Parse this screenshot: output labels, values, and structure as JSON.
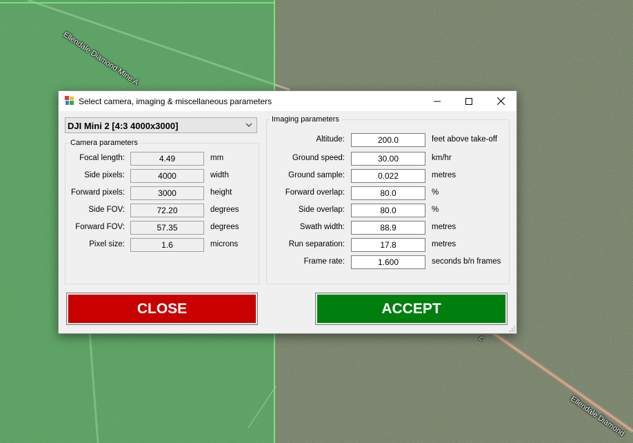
{
  "map": {
    "road_label_top": "Ellendale Diamond Mine A",
    "road_label_bottom": "Ellendale Diamond",
    "road_label_small": "c"
  },
  "dialog": {
    "title": "Select camera, imaging & miscellaneous parameters",
    "camera_select": {
      "value": "DJI Mini 2 [4:3 4000x3000]"
    },
    "camera_parameters": {
      "title": "Camera parameters",
      "rows": [
        {
          "label": "Focal length:",
          "value": "4.49",
          "unit": "mm"
        },
        {
          "label": "Side pixels:",
          "value": "4000",
          "unit": "width"
        },
        {
          "label": "Forward pixels:",
          "value": "3000",
          "unit": "height"
        },
        {
          "label": "Side FOV:",
          "value": "72.20",
          "unit": "degrees"
        },
        {
          "label": "Forward FOV:",
          "value": "57.35",
          "unit": "degrees"
        },
        {
          "label": "Pixel size:",
          "value": "1.6",
          "unit": "microns"
        }
      ]
    },
    "imaging_parameters": {
      "title": "Imaging parameters",
      "rows": [
        {
          "label": "Altitude:",
          "value": "200.0",
          "unit": "feet above take-off"
        },
        {
          "label": "Ground speed:",
          "value": "30.00",
          "unit": "km/hr"
        },
        {
          "label": "Ground sample:",
          "value": "0.022",
          "unit": "metres"
        },
        {
          "label": "Forward overlap:",
          "value": "80.0",
          "unit": "%"
        },
        {
          "label": "Side overlap:",
          "value": "80.0",
          "unit": "%"
        },
        {
          "label": "Swath width:",
          "value": "88.9",
          "unit": "metres"
        },
        {
          "label": "Run separation:",
          "value": "17.8",
          "unit": "metres"
        },
        {
          "label": "Frame rate:",
          "value": "1.600",
          "unit": "seconds b/n frames"
        }
      ]
    },
    "buttons": {
      "close": "CLOSE",
      "accept": "ACCEPT"
    }
  },
  "colors": {
    "close_button": "#c80000",
    "accept_button": "#007f0e",
    "map_overlay": "#3cc35a"
  }
}
